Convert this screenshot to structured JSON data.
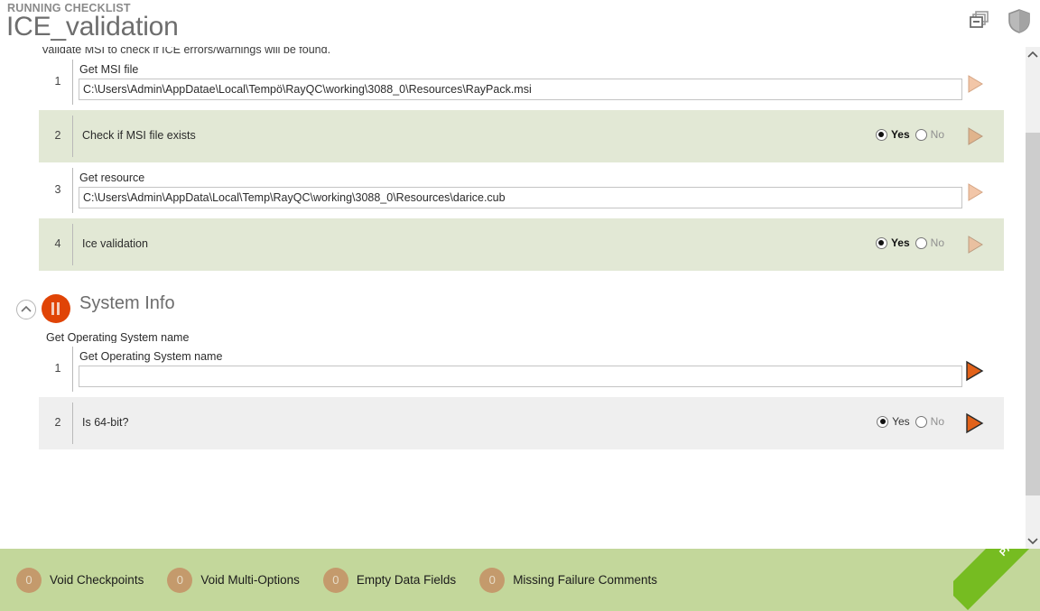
{
  "header": {
    "kicker": "RUNNING CHECKLIST",
    "title": "ICE_validation",
    "icons": {
      "windows": "stack-windows-icon",
      "shield": "shield-icon"
    }
  },
  "description": "Validate MSI to check if ICE errors/warnings will be found.",
  "sections": [
    {
      "id": "ice-validation",
      "rows": [
        {
          "num": "1",
          "type": "field",
          "label": "Get MSI file",
          "value": "C:\\Users\\Admin\\AppDatae\\Local\\Tempö\\RayQC\\working\\3088_0\\Resources\\RayPack.msi",
          "placeholder": "",
          "bg": "white",
          "arrow": "disabled"
        },
        {
          "num": "2",
          "type": "choice",
          "label": "Check if MSI file exists",
          "yes_label": "Yes",
          "no_label": "No",
          "selected": "yes",
          "bg": "green",
          "arrow": "disabled"
        },
        {
          "num": "3",
          "type": "field",
          "label": "Get resource",
          "value": "C:\\Users\\Admin\\AppData\\Local\\Temp\\RayQC\\working\\3088_0\\Resources\\darice.cub",
          "placeholder": "",
          "bg": "white",
          "arrow": "disabled"
        },
        {
          "num": "4",
          "type": "choice",
          "label": "Ice validation",
          "yes_label": "Yes",
          "no_label": "No",
          "selected": "yes",
          "bg": "green",
          "arrow": "disabled"
        }
      ]
    },
    {
      "id": "system-info",
      "title": "System Info",
      "subtitle": "Get Operating System name",
      "status_icon": "pause-icon",
      "status_color": "#e04406",
      "collapse_icon": "chevron-up-icon",
      "rows": [
        {
          "num": "1",
          "type": "field",
          "label": "Get Operating System name",
          "value": "",
          "placeholder": "",
          "bg": "white",
          "arrow": "active"
        },
        {
          "num": "2",
          "type": "choice",
          "label": "Is 64-bit?",
          "yes_label": "Yes",
          "no_label": "No",
          "selected": "yes",
          "bg": "gray",
          "arrow": "active"
        }
      ]
    }
  ],
  "scrollbar": {
    "up_icon": "chevron-up-icon",
    "down_icon": "chevron-down-icon"
  },
  "footer": {
    "stats": [
      {
        "count": "0",
        "label": "Void Checkpoints"
      },
      {
        "count": "0",
        "label": "Void Multi-Options"
      },
      {
        "count": "0",
        "label": "Empty Data Fields"
      },
      {
        "count": "0",
        "label": "Missing Failure Comments"
      }
    ],
    "ribbon_label": "PASSED",
    "bg_color": "#c3d79b",
    "ribbon_color": "#76bc21"
  }
}
